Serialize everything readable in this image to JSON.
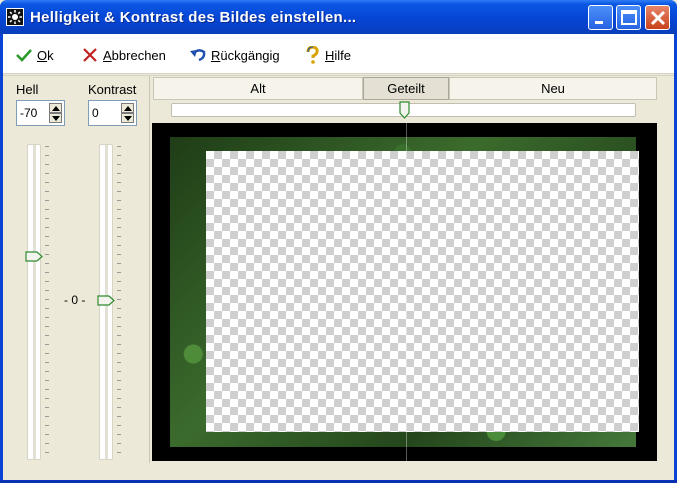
{
  "window": {
    "title": "Helligkeit & Kontrast des Bildes einstellen..."
  },
  "toolbar": {
    "ok_label": "Ok",
    "cancel_label": "Abbrechen",
    "undo_label": "Rückgängig",
    "help_label": "Hilfe"
  },
  "controls": {
    "brightness_label": "Hell",
    "brightness_value": "-70",
    "contrast_label": "Kontrast",
    "contrast_value": "0",
    "zero_marker": "- 0 -"
  },
  "tabs": [
    {
      "label": "Alt",
      "active": false
    },
    {
      "label": "Geteilt",
      "active": true
    },
    {
      "label": "Neu",
      "active": false
    }
  ],
  "colors": {
    "title_bar": "#0748d8",
    "face": "#ece9d8",
    "accent_ok": "#2a9a2a",
    "cancel": "#c02020"
  },
  "icons": [
    "app-icon",
    "minimize-icon",
    "maximize-icon",
    "close-icon",
    "checkmark-icon",
    "x-cross-icon",
    "undo-arrow-icon",
    "help-question-icon"
  ]
}
